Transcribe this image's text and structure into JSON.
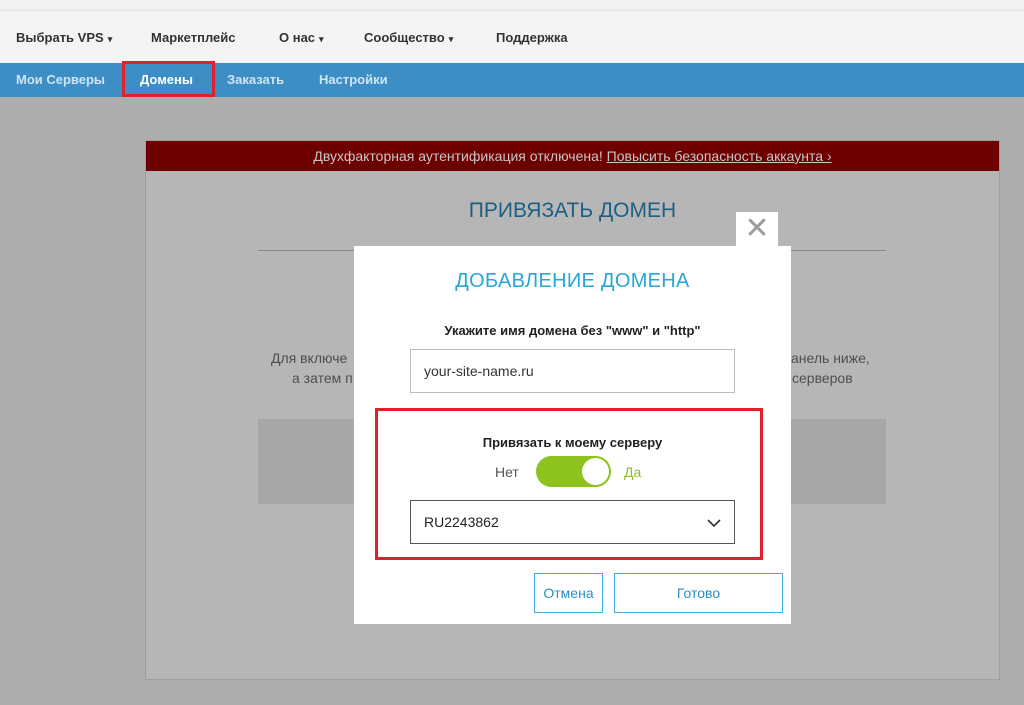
{
  "top_nav": {
    "items": [
      {
        "label": "Выбрать VPS",
        "caret": "▾"
      },
      {
        "label": "Маркетплейс",
        "caret": ""
      },
      {
        "label": "О нас",
        "caret": "▾"
      },
      {
        "label": "Сообщество",
        "caret": "▾"
      },
      {
        "label": "Поддержка",
        "caret": ""
      }
    ]
  },
  "sub_nav": {
    "items": [
      {
        "label": "Мои Серверы"
      },
      {
        "label": "Домены"
      },
      {
        "label": "Заказать"
      },
      {
        "label": "Настройки"
      }
    ],
    "active": "Домены"
  },
  "alert": {
    "text": "Двухфакторная аутентификация отключена! ",
    "link": "Повысить безопасность аккаунта ›"
  },
  "background": {
    "title": "ПРИВЯЗАТЬ ДОМЕН",
    "text_left_1": "Для включе",
    "text_right_1": "анель ниже,",
    "text_left_2": "а затем п",
    "text_right_2": "серверов"
  },
  "modal": {
    "close_symbol": "✕",
    "title": "ДОБАВЛЕНИЕ ДОМЕНА",
    "domain_label": "Укажите имя домена без \"www\" и \"http\"",
    "domain_placeholder": "your-site-name.ru",
    "bind_label": "Привязать к моему серверу",
    "toggle_no": "Нет",
    "toggle_yes": "Да",
    "toggle_on": true,
    "server_value": "RU2243862",
    "cancel_label": "Отмена",
    "done_label": "Готово"
  },
  "colors": {
    "accent": "#27a6d8",
    "toggle_on": "#8ec21f",
    "alert_bg": "#6e0000",
    "sub_nav_bg": "#3e8ec6",
    "highlight": "#e0202a"
  },
  "icons": {
    "close": "close-icon",
    "dropdown": "chevron-down-icon",
    "nav_caret": "caret-down-icon"
  }
}
